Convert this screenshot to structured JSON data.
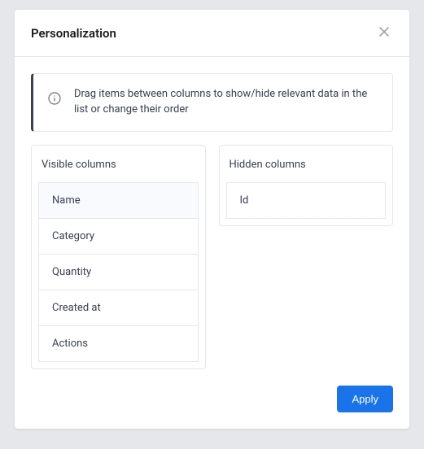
{
  "modal": {
    "title": "Personalization",
    "hint": "Drag items between columns to show/hide relevant data in the list or change their order",
    "visible_header": "Visible columns",
    "hidden_header": "Hidden columns",
    "apply_label": "Apply"
  },
  "visible_columns": [
    {
      "label": "Name",
      "selected": true
    },
    {
      "label": "Category",
      "selected": false
    },
    {
      "label": "Quantity",
      "selected": false
    },
    {
      "label": "Created at",
      "selected": false
    },
    {
      "label": "Actions",
      "selected": false
    }
  ],
  "hidden_columns": [
    {
      "label": "Id",
      "selected": false
    }
  ]
}
